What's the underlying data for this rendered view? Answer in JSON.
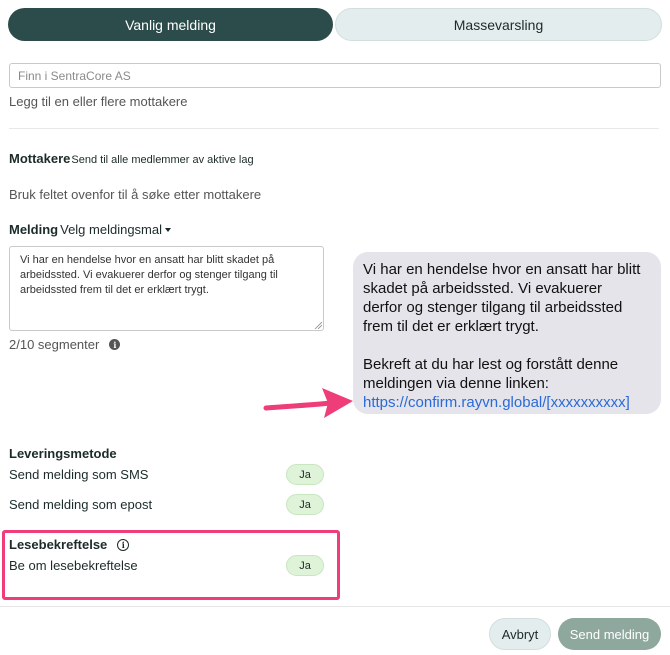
{
  "tabs": [
    {
      "label": "Vanlig melding",
      "active": true
    },
    {
      "label": "Massevarsling",
      "active": false
    }
  ],
  "recipients": {
    "search_placeholder": "Finn i SentraCore AS",
    "hint": "Legg til en eller flere mottakere",
    "title": "Mottakere",
    "send_all_link": "Send til alle medlemmer av aktive lag",
    "empty_text": "Bruk feltet ovenfor til å søke etter mottakere"
  },
  "message": {
    "title": "Melding",
    "template_link": "Velg meldingsmal",
    "body": "Vi har en hendelse hvor en ansatt har blitt skadet på arbeidssted. Vi evakuerer derfor og stenger tilgang til arbeidssted frem til det er erklært trygt.",
    "segments": "2/10 segmenter"
  },
  "preview": {
    "line1": "Vi har en hendelse hvor en ansatt har blitt",
    "line2": "skadet på arbeidssted. Vi evakuerer",
    "line3": "derfor og stenger tilgang til arbeidssted",
    "line4": "frem til det er erklært trygt.",
    "line5": "Bekreft at du har lest og forstått denne",
    "line6": "meldingen via denne linken:",
    "link": "https://confirm.rayvn.global/[xxxxxxxxxx]"
  },
  "delivery": {
    "title": "Leveringsmetode",
    "sms_label": "Send melding som SMS",
    "sms_value": "Ja",
    "email_label": "Send melding som epost",
    "email_value": "Ja"
  },
  "read_receipt": {
    "title": "Lesebekreftelse",
    "label": "Be om lesebekreftelse",
    "value": "Ja"
  },
  "footer": {
    "cancel_label": "Avbryt",
    "send_label": "Send melding"
  },
  "colors": {
    "accent": "#2c4c4b",
    "highlight": "#ee3d79",
    "toggle_on": "#dff3d9",
    "link": "#2a6ad6"
  }
}
